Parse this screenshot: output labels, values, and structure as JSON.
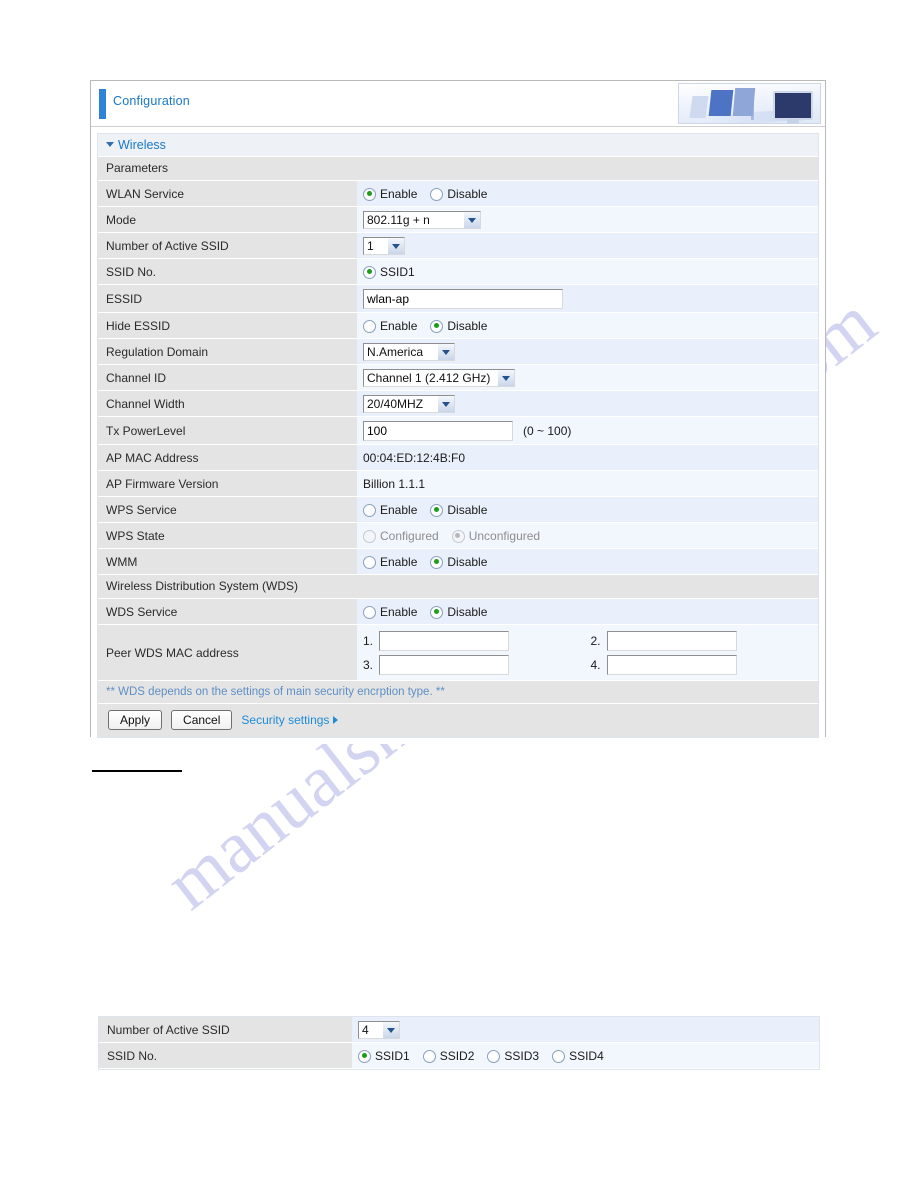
{
  "header": {
    "title": "Configuration",
    "artwork": "office-desk-photo"
  },
  "section": {
    "title": "Wireless",
    "parameters_heading": "Parameters",
    "wds_heading": "Wireless Distribution System (WDS)"
  },
  "rows": {
    "wlan_service": {
      "label": "WLAN Service",
      "options": [
        "Enable",
        "Disable"
      ],
      "selected": "Enable"
    },
    "mode": {
      "label": "Mode",
      "value": "802.11g + n"
    },
    "num_active_ssid": {
      "label": "Number of Active SSID",
      "value": "1"
    },
    "ssid_no": {
      "label": "SSID No.",
      "options": [
        "SSID1"
      ],
      "selected": "SSID1"
    },
    "essid": {
      "label": "ESSID",
      "value": "wlan-ap"
    },
    "hide_essid": {
      "label": "Hide ESSID",
      "options": [
        "Enable",
        "Disable"
      ],
      "selected": "Disable"
    },
    "regulation_domain": {
      "label": "Regulation Domain",
      "value": "N.America"
    },
    "channel_id": {
      "label": "Channel ID",
      "value": "Channel 1 (2.412 GHz)"
    },
    "channel_width": {
      "label": "Channel Width",
      "value": "20/40MHZ"
    },
    "tx_power_level": {
      "label": "Tx PowerLevel",
      "value": "100",
      "hint": "(0 ~ 100)"
    },
    "ap_mac_address": {
      "label": "AP MAC Address",
      "value": "00:04:ED:12:4B:F0"
    },
    "ap_firmware_version": {
      "label": "AP Firmware Version",
      "value": "Billion 1.1.1"
    },
    "wps_service": {
      "label": "WPS Service",
      "options": [
        "Enable",
        "Disable"
      ],
      "selected": "Disable"
    },
    "wps_state": {
      "label": "WPS State",
      "options": [
        "Configured",
        "Unconfigured"
      ],
      "selected": "Unconfigured",
      "disabled": true
    },
    "wmm": {
      "label": "WMM",
      "options": [
        "Enable",
        "Disable"
      ],
      "selected": "Disable"
    },
    "wds_service": {
      "label": "WDS Service",
      "options": [
        "Enable",
        "Disable"
      ],
      "selected": "Disable"
    },
    "peer_wds_mac": {
      "label": "Peer WDS MAC address",
      "entries": [
        {
          "num": "1.",
          "value": ""
        },
        {
          "num": "2.",
          "value": ""
        },
        {
          "num": "3.",
          "value": ""
        },
        {
          "num": "4.",
          "value": ""
        }
      ]
    }
  },
  "note": "** WDS depends on the settings of main security encrption type. **",
  "buttons": {
    "apply": "Apply",
    "cancel": "Cancel",
    "security_settings": "Security settings"
  },
  "bottom_panel": {
    "num_active_ssid": {
      "label": "Number of Active SSID",
      "value": "4"
    },
    "ssid_no": {
      "label": "SSID No.",
      "options": [
        "SSID1",
        "SSID2",
        "SSID3",
        "SSID4"
      ],
      "selected": "SSID1"
    }
  },
  "watermark": {
    "line1": "manualshive.com",
    "line2": "manualshive.com",
    "color": "#ccccf0"
  },
  "colors": {
    "accent_blue": "#1978c8",
    "label_bg": "#e4e4e4",
    "value_bg": "#eaf0fb",
    "radio_on": "#18a018",
    "link": "#1e8bd8"
  }
}
